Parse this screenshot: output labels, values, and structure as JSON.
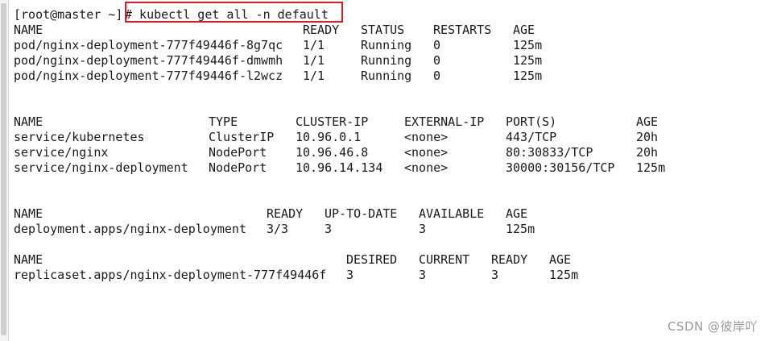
{
  "prompt": "[root@master ~]",
  "command": "# kubectl get all -n default",
  "pods": {
    "headers": [
      "NAME",
      "READY",
      "STATUS",
      "RESTARTS",
      "AGE"
    ],
    "rows": [
      [
        "pod/nginx-deployment-777f49446f-8g7qc",
        "1/1",
        "Running",
        "0",
        "125m"
      ],
      [
        "pod/nginx-deployment-777f49446f-dmwmh",
        "1/1",
        "Running",
        "0",
        "125m"
      ],
      [
        "pod/nginx-deployment-777f49446f-l2wcz",
        "1/1",
        "Running",
        "0",
        "125m"
      ]
    ]
  },
  "services": {
    "headers": [
      "NAME",
      "TYPE",
      "CLUSTER-IP",
      "EXTERNAL-IP",
      "PORT(S)",
      "AGE"
    ],
    "rows": [
      [
        "service/kubernetes",
        "ClusterIP",
        "10.96.0.1",
        "<none>",
        "443/TCP",
        "20h"
      ],
      [
        "service/nginx",
        "NodePort",
        "10.96.46.8",
        "<none>",
        "80:30833/TCP",
        "20h"
      ],
      [
        "service/nginx-deployment",
        "NodePort",
        "10.96.14.134",
        "<none>",
        "30000:30156/TCP",
        "125m"
      ]
    ]
  },
  "deployments": {
    "headers": [
      "NAME",
      "READY",
      "UP-TO-DATE",
      "AVAILABLE",
      "AGE"
    ],
    "rows": [
      [
        "deployment.apps/nginx-deployment",
        "3/3",
        "3",
        "3",
        "125m"
      ]
    ]
  },
  "replicasets": {
    "headers": [
      "NAME",
      "DESIRED",
      "CURRENT",
      "READY",
      "AGE"
    ],
    "rows": [
      [
        "replicaset.apps/nginx-deployment-777f49446f",
        "3",
        "3",
        "3",
        "125m"
      ]
    ]
  },
  "watermark": "CSDN @彼岸吖",
  "colors": {
    "highlight_box": "#e01b24",
    "text": "#1a1a1a",
    "watermark": "#9a9a9a"
  }
}
